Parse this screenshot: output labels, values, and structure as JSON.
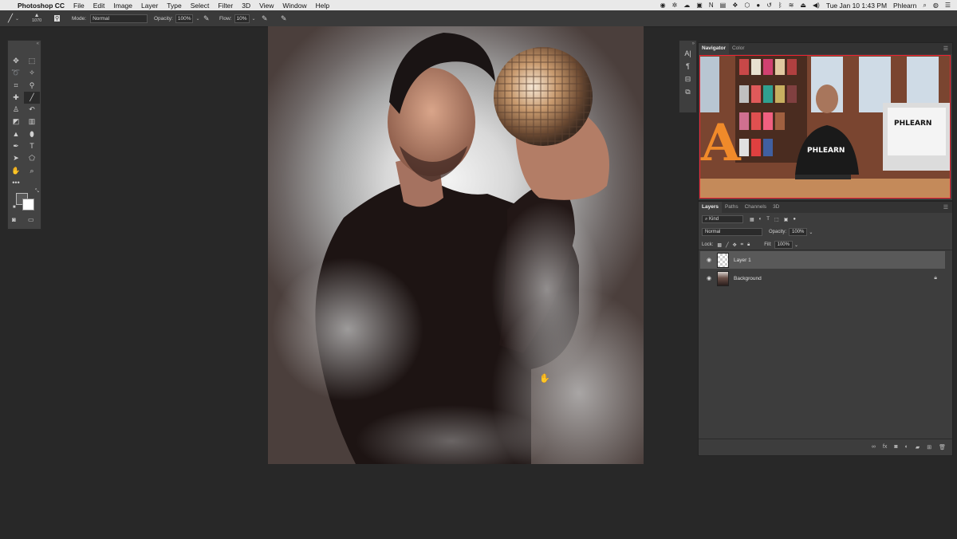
{
  "menubar": {
    "apple": "",
    "app": "Photoshop CC",
    "items": [
      "File",
      "Edit",
      "Image",
      "Layer",
      "Type",
      "Select",
      "Filter",
      "3D",
      "View",
      "Window",
      "Help"
    ],
    "clock": "Tue Jan 10  1:43 PM",
    "user": "Phlearn"
  },
  "options": {
    "brush_size": "1070",
    "mode_label": "Mode:",
    "mode_value": "Normal",
    "opacity_label": "Opacity:",
    "opacity_value": "100%",
    "flow_label": "Flow:",
    "flow_value": "10%"
  },
  "navigator": {
    "tabs": [
      "Navigator",
      "Color"
    ],
    "preview_sign": "PHLEARN",
    "preview_shirt": "PHLEARN",
    "preview_letter": "A"
  },
  "side_icons": {
    "char": "A|",
    "para": "¶"
  },
  "layers": {
    "tabs": [
      "Layers",
      "Paths",
      "Channels",
      "3D"
    ],
    "filter_kind": "Kind",
    "blend_mode": "Normal",
    "opacity_label": "Opacity:",
    "opacity_value": "100%",
    "lock_label": "Lock:",
    "fill_label": "Fill:",
    "fill_value": "100%",
    "items": [
      {
        "name": "Layer 1",
        "selected": true
      },
      {
        "name": "Background",
        "selected": false
      }
    ]
  },
  "colors": {
    "foreground": "#595959",
    "background": "#ffffff"
  }
}
